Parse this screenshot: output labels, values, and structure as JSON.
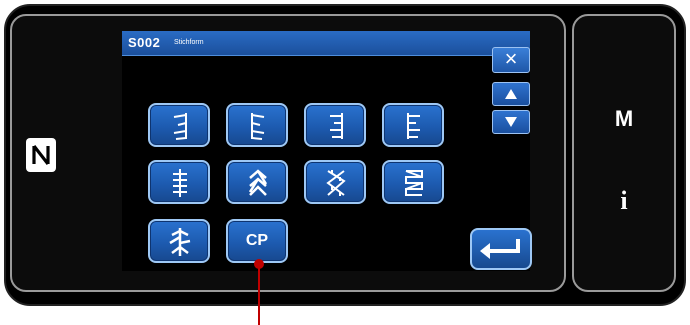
{
  "dialog": {
    "code": "S002",
    "title": "Stichform",
    "close_label": "×"
  },
  "stitch_buttons": [
    {
      "icon": "stitch-pattern-1-icon"
    },
    {
      "icon": "stitch-pattern-2-icon"
    },
    {
      "icon": "stitch-pattern-3-icon"
    },
    {
      "icon": "stitch-pattern-4-icon"
    },
    {
      "icon": "stitch-pattern-5-icon"
    },
    {
      "icon": "stitch-pattern-6-icon"
    },
    {
      "icon": "stitch-pattern-7-icon"
    },
    {
      "icon": "stitch-pattern-8-icon"
    },
    {
      "icon": "stitch-pattern-9-icon"
    },
    {
      "label": "CP"
    }
  ],
  "side": {
    "mode_label": "M",
    "info_label": "i"
  },
  "colors": {
    "button_blue": "#1d5bb0",
    "button_border": "#9ec8f5",
    "callout_red": "#c00000"
  }
}
